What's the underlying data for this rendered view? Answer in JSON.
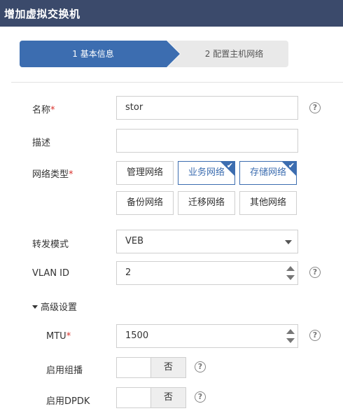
{
  "window": {
    "title": "增加虚拟交换机"
  },
  "steps": [
    {
      "label": "1 基本信息",
      "active": true
    },
    {
      "label": "2 配置主机网络",
      "active": false
    }
  ],
  "form": {
    "name": {
      "label": "名称",
      "required_mark": "*",
      "value": "stor"
    },
    "desc": {
      "label": "描述",
      "value": ""
    },
    "net_type": {
      "label": "网络类型",
      "required_mark": "*",
      "options": [
        {
          "label": "管理网络",
          "selected": false
        },
        {
          "label": "业务网络",
          "selected": true
        },
        {
          "label": "存储网络",
          "selected": true
        },
        {
          "label": "备份网络",
          "selected": false
        },
        {
          "label": "迁移网络",
          "selected": false
        },
        {
          "label": "其他网络",
          "selected": false
        }
      ]
    },
    "forward_mode": {
      "label": "转发模式",
      "value": "VEB"
    },
    "vlan_id": {
      "label": "VLAN ID",
      "value": "2"
    },
    "advanced": {
      "label": "高级设置",
      "expanded": true
    },
    "mtu": {
      "label": "MTU",
      "required_mark": "*",
      "value": "1500"
    },
    "multicast": {
      "label": "启用组播",
      "state_label": "否"
    },
    "dpdk": {
      "label": "启用DPDK",
      "state_label": "否"
    }
  },
  "icons": {
    "help": "?",
    "check": "✔"
  },
  "colors": {
    "titlebar": "#3b4a6b",
    "accent": "#3c6db0",
    "required": "#d9302b"
  }
}
